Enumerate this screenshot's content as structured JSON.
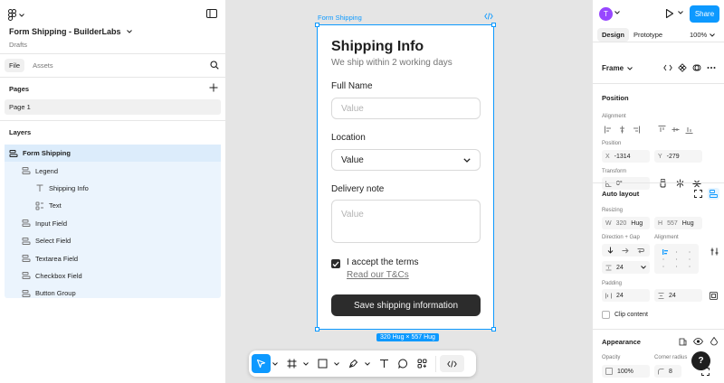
{
  "file": {
    "title": "Form Shipping - BuilderLabs",
    "location": "Drafts"
  },
  "left_tabs": [
    "File",
    "Assets"
  ],
  "pages": {
    "header": "Pages",
    "items": [
      "Page 1"
    ]
  },
  "layers": {
    "header": "Layers",
    "items": [
      {
        "label": "Form Shipping",
        "icon": "auto-layout-frame-icon"
      },
      {
        "label": "Legend",
        "icon": "auto-layout-icon"
      },
      {
        "label": "Shipping Info",
        "icon": "text-icon"
      },
      {
        "label": "Text",
        "icon": "component-instance-icon"
      },
      {
        "label": "Input Field",
        "icon": "auto-layout-icon"
      },
      {
        "label": "Select Field",
        "icon": "auto-layout-icon"
      },
      {
        "label": "Textarea Field",
        "icon": "auto-layout-icon"
      },
      {
        "label": "Checkbox Field",
        "icon": "auto-layout-icon"
      },
      {
        "label": "Button Group",
        "icon": "auto-layout-icon"
      }
    ]
  },
  "canvas": {
    "frame_label": "Form Shipping",
    "size_badge": "320 Hug × 557 Hug",
    "form": {
      "title": "Shipping Info",
      "subtitle": "We ship within 2 working days",
      "full_name_label": "Full Name",
      "full_name_placeholder": "Value",
      "location_label": "Location",
      "location_value": "Value",
      "delivery_label": "Delivery note",
      "delivery_placeholder": "Value",
      "checkbox_label": "I accept the terms",
      "checkbox_checked": true,
      "link_text": "Read our T&Cs",
      "submit_label": "Save shipping information"
    }
  },
  "toolbar": {
    "tools": [
      "move-icon",
      "frame-icon",
      "rectangle-icon",
      "pen-icon",
      "text-icon",
      "comment-icon",
      "actions-icon",
      "dev-mode-icon"
    ],
    "active": "move-icon"
  },
  "right": {
    "avatar_letter": "T",
    "share_label": "Share",
    "tabs": [
      "Design",
      "Prototype"
    ],
    "zoom": "100%",
    "frame_type": "Frame",
    "position_header": "Position",
    "alignment_label": "Alignment",
    "position_label": "Position",
    "x_key": "X",
    "x_value": "-1314",
    "y_key": "Y",
    "y_value": "-279",
    "transform_label": "Transform",
    "rotation": "0°",
    "auto_layout_header": "Auto layout",
    "resizing_label": "Resizing",
    "w_key": "W",
    "w_value": "320",
    "w_mode": "Hug",
    "h_key": "H",
    "h_value": "557",
    "h_mode": "Hug",
    "direction_gap_label": "Direction + Gap",
    "al_alignment_label": "Alignment",
    "gap_value": "24",
    "padding_label": "Padding",
    "padding_h": "24",
    "padding_v": "24",
    "clip_content_label": "Clip content",
    "appearance_header": "Appearance",
    "opacity_label": "Opacity",
    "opacity_value": "100%",
    "corner_radius_label": "Corner radius",
    "corner_radius_value": "8"
  },
  "help_label": "?",
  "colors": {
    "accent": "#0d99ff",
    "selection_bg": "#ebf4fd",
    "button_dark": "#2c2c2c",
    "avatar": "#9747ff"
  }
}
